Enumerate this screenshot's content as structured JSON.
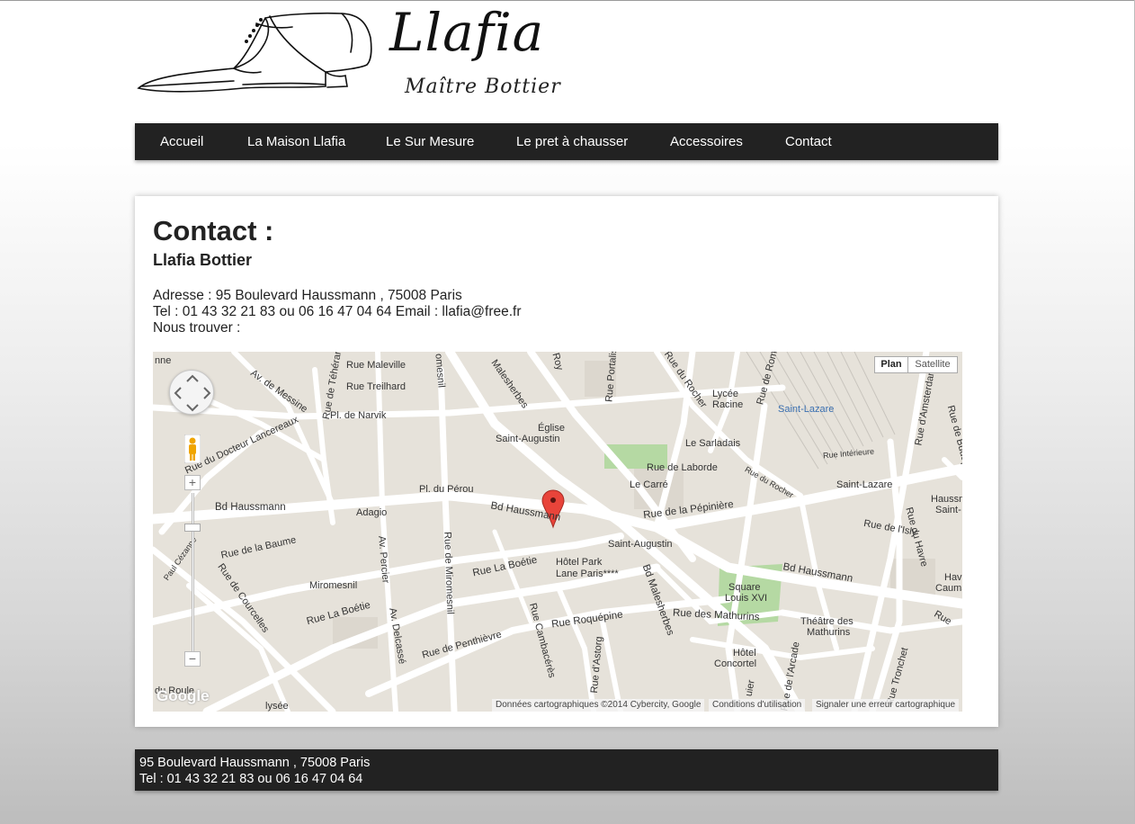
{
  "logo": {
    "title": "Llafia",
    "subtitle": "Maître Bottier"
  },
  "nav": {
    "items": [
      {
        "label": "Accueil"
      },
      {
        "label": "La Maison Llafia"
      },
      {
        "label": "Le Sur Mesure"
      },
      {
        "label": "Le pret à chausser"
      },
      {
        "label": "Accessoires"
      },
      {
        "label": "Contact"
      }
    ]
  },
  "main": {
    "title": "Contact :",
    "subtitle": "Llafia Bottier",
    "address_line": "Adresse : 95 Boulevard Haussmann , 75008 Paris",
    "phone_line": "Tel : 01 43 32 21 83 ou 06 16 47 04 64 Email : llafia@free.fr",
    "find_line": "Nous trouver :"
  },
  "map": {
    "type_buttons": {
      "plan": "Plan",
      "satellite": "Satellite"
    },
    "zoom_in": "+",
    "zoom_out": "−",
    "google_logo": "Google",
    "attribution": {
      "data": "Données cartographiques ©2014 Cybercity, Google",
      "terms": "Conditions d'utilisation",
      "report": "Signaler une erreur cartographique"
    },
    "labels": {
      "rue_maleville": "Rue Maleville",
      "rue_treilhard": "Rue Treilhard",
      "av_messine": "Av. de Messine",
      "rue_teheran": "Rue de Téhéran",
      "pl_narvik": "Pl. de Narvik",
      "rue_docteur": "Rue du Docteur Lancereaux",
      "pl_perou": "Pl. du Pérou",
      "bd_haussmann_w": "Bd Haussmann",
      "adagio": "Adagio",
      "bd_haussmann_c": "Bd Haussmann",
      "rue_pepiniere": "Rue de la Pépinière",
      "rue_baume": "Rue de la Baume",
      "rue_courcelles": "Rue de Courcelles",
      "miromesnil": "Miromesnil",
      "av_percier": "Av. Percier",
      "rue_boetie_w": "Rue La Boétie",
      "av_delcasse": "Av. Delcassé",
      "rue_boetie_c": "Rue La Boétie",
      "rue_miromesnil": "Rue de Miromesnil",
      "rue_penthievre": "Rue de Penthièvre",
      "rue_roquepine": "Rue Roquépine",
      "rue_cambaceres": "Rue Cambacérès",
      "rue_astorg": "Rue d'Astorg",
      "bd_malesherbes_s": "Bd Malesherbes",
      "bd_malesherbes_n": "Bd Malesherbes",
      "eglise": "Église",
      "saint_augustin_church": "Saint-Augustin",
      "hotel_park": "Hôtel Park",
      "lane_paris": "Lane Paris****",
      "saint_augustin_metro": "Saint-Augustin",
      "le_sarladais": "Le Sarladais",
      "rue_laborde": "Rue de Laborde",
      "le_carre": "Le Carré",
      "lycee": "Lycée",
      "racine": "Racine",
      "rue_rocher": "Rue du Rocher",
      "rue_rocher_s": "Rue du Rocher",
      "rue_rome": "Rue de Rome",
      "saint_lazare_station": "Saint-Lazare",
      "rue_interieure": "Rue Intérieure",
      "saint_lazare_metro": "Saint-Lazare",
      "haussm": "Haussm",
      "saint_e": "Saint-",
      "rue_isly": "Rue de l'Isly",
      "rue_amsterdam": "Rue d'Amsterdam",
      "rue_budapest": "Rue de Budapest",
      "rue_havre": "Rue du Havre",
      "square": "Square",
      "louis_xvi": "Louis XVI",
      "bd_haussmann_e": "Bd Haussmann",
      "rue_mathurins": "Rue des Mathurins",
      "theatre": "Théâtre des",
      "mathurins": "Mathurins",
      "hotel": "Hôtel",
      "concortel": "Concortel",
      "rue_arcade": "Rue de l'Arcade",
      "rue_tronchet": "Rue Tronchet",
      "havr": "Hav",
      "caumar": "Cauma",
      "rue_e": "Rue",
      "du_roule": "du Roule",
      "paul_cezanne": "Paul Cézanne",
      "rue_portalis": "Rue Portalis",
      "rue_roy": "Roy",
      "elysee": "lysée",
      "ne": "nne",
      "rue_miro_top": "omesnil",
      "rue_mal_top": "Malesherbes",
      "rue_quier": "uier"
    }
  },
  "footer": {
    "address": "95 Boulevard Haussmann , 75008 Paris",
    "phone": "Tel : 01 43 32 21 83 ou 06 16 47 04 64"
  }
}
